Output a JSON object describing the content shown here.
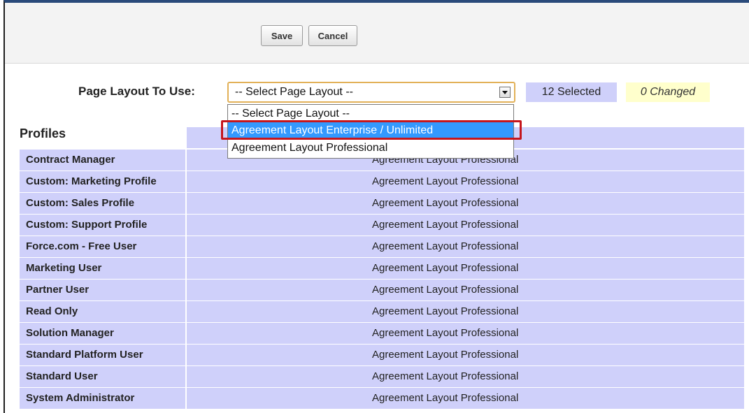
{
  "toolbar": {
    "save_label": "Save",
    "cancel_label": "Cancel"
  },
  "layout_picker": {
    "label": "Page Layout To Use:",
    "selected_value": "-- Select Page Layout --",
    "options": [
      "-- Select Page Layout --",
      "Agreement Layout Enterprise / Unlimited",
      "Agreement Layout Professional"
    ],
    "highlighted_option": "Agreement Layout Enterprise / Unlimited",
    "selected_count": "12 Selected",
    "changed_count": "0 Changed"
  },
  "profiles_table": {
    "header": "Profiles",
    "rows": [
      {
        "profile": "Contract Manager",
        "layout": "Agreement Layout Professional"
      },
      {
        "profile": "Custom: Marketing Profile",
        "layout": "Agreement Layout Professional"
      },
      {
        "profile": "Custom: Sales Profile",
        "layout": "Agreement Layout Professional"
      },
      {
        "profile": "Custom: Support Profile",
        "layout": "Agreement Layout Professional"
      },
      {
        "profile": "Force.com - Free User",
        "layout": "Agreement Layout Professional"
      },
      {
        "profile": "Marketing User",
        "layout": "Agreement Layout Professional"
      },
      {
        "profile": "Partner User",
        "layout": "Agreement Layout Professional"
      },
      {
        "profile": "Read Only",
        "layout": "Agreement Layout Professional"
      },
      {
        "profile": "Solution Manager",
        "layout": "Agreement Layout Professional"
      },
      {
        "profile": "Standard Platform User",
        "layout": "Agreement Layout Professional"
      },
      {
        "profile": "Standard User",
        "layout": "Agreement Layout Professional"
      },
      {
        "profile": "System Administrator",
        "layout": "Agreement Layout Professional"
      }
    ]
  },
  "colors": {
    "selection_band": "#cfd0fa",
    "changed_badge": "#ffffcc",
    "dropdown_highlight": "#3399ff",
    "annotation_box": "#c5161d"
  }
}
